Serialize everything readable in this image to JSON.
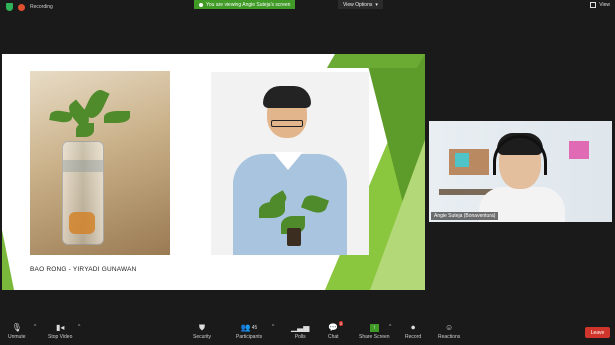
{
  "top": {
    "recording_label": "Recording",
    "share_banner": "You are viewing Angie Suteja's screen",
    "view_options": "View Options",
    "view_label": "View"
  },
  "slide": {
    "caption": "BAO RONG - YIRYADI GUNAWAN"
  },
  "tile": {
    "name": "Angie Suteja (Bonaventura)"
  },
  "toolbar": {
    "items": [
      {
        "label": "Unmute",
        "icon": "mic-muted-icon"
      },
      {
        "label": "Stop Video",
        "icon": "video-camera-icon"
      },
      {
        "label": "Security",
        "icon": "shield-icon"
      },
      {
        "label": "Participants",
        "icon": "participants-icon",
        "count": "45"
      },
      {
        "label": "Polls",
        "icon": "bar-chart-icon"
      },
      {
        "label": "Chat",
        "icon": "chat-icon",
        "badge": "2"
      },
      {
        "label": "Share Screen",
        "icon": "share-screen-icon"
      },
      {
        "label": "Record",
        "icon": "record-icon"
      },
      {
        "label": "Reactions",
        "icon": "smiley-icon"
      }
    ],
    "leave_label": "Leave"
  },
  "colors": {
    "share_green": "#3f9a26",
    "leave_red": "#d0352b",
    "slide_green": "#8bc63f"
  }
}
